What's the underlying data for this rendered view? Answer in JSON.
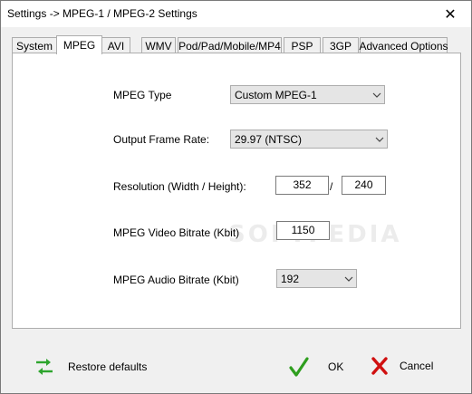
{
  "window": {
    "title": "Settings -> MPEG-1 / MPEG-2 Settings",
    "close_glyph": "✕"
  },
  "tabs": [
    {
      "label": "System",
      "active": false
    },
    {
      "label": "MPEG",
      "active": true
    },
    {
      "label": "AVI",
      "active": false
    },
    {
      "label": "WMV",
      "active": false
    },
    {
      "label": "Pod/Pad/Mobile/MP4",
      "active": false
    },
    {
      "label": "PSP",
      "active": false
    },
    {
      "label": "3GP",
      "active": false
    },
    {
      "label": "Advanced Options",
      "active": false
    }
  ],
  "form": {
    "mpeg_type": {
      "label": "MPEG Type",
      "value": "Custom MPEG-1"
    },
    "frame_rate": {
      "label": "Output Frame Rate:",
      "value": "29.97 (NTSC)"
    },
    "resolution": {
      "label": "Resolution (Width / Height):",
      "width": "352",
      "separator": "/",
      "height": "240"
    },
    "video_bitrate": {
      "label": "MPEG Video Bitrate (Kbit)",
      "value": "1150"
    },
    "audio_bitrate": {
      "label": "MPEG Audio Bitrate (Kbit)",
      "value": "192"
    }
  },
  "buttons": {
    "restore_label": "Restore defaults",
    "ok_label": "OK",
    "cancel_label": "Cancel"
  },
  "watermark": "SOFTPEDIA",
  "colors": {
    "ok_check": "#2e9e1e",
    "cancel_x": "#d01010",
    "restore_arrows": "#2ea52e"
  }
}
